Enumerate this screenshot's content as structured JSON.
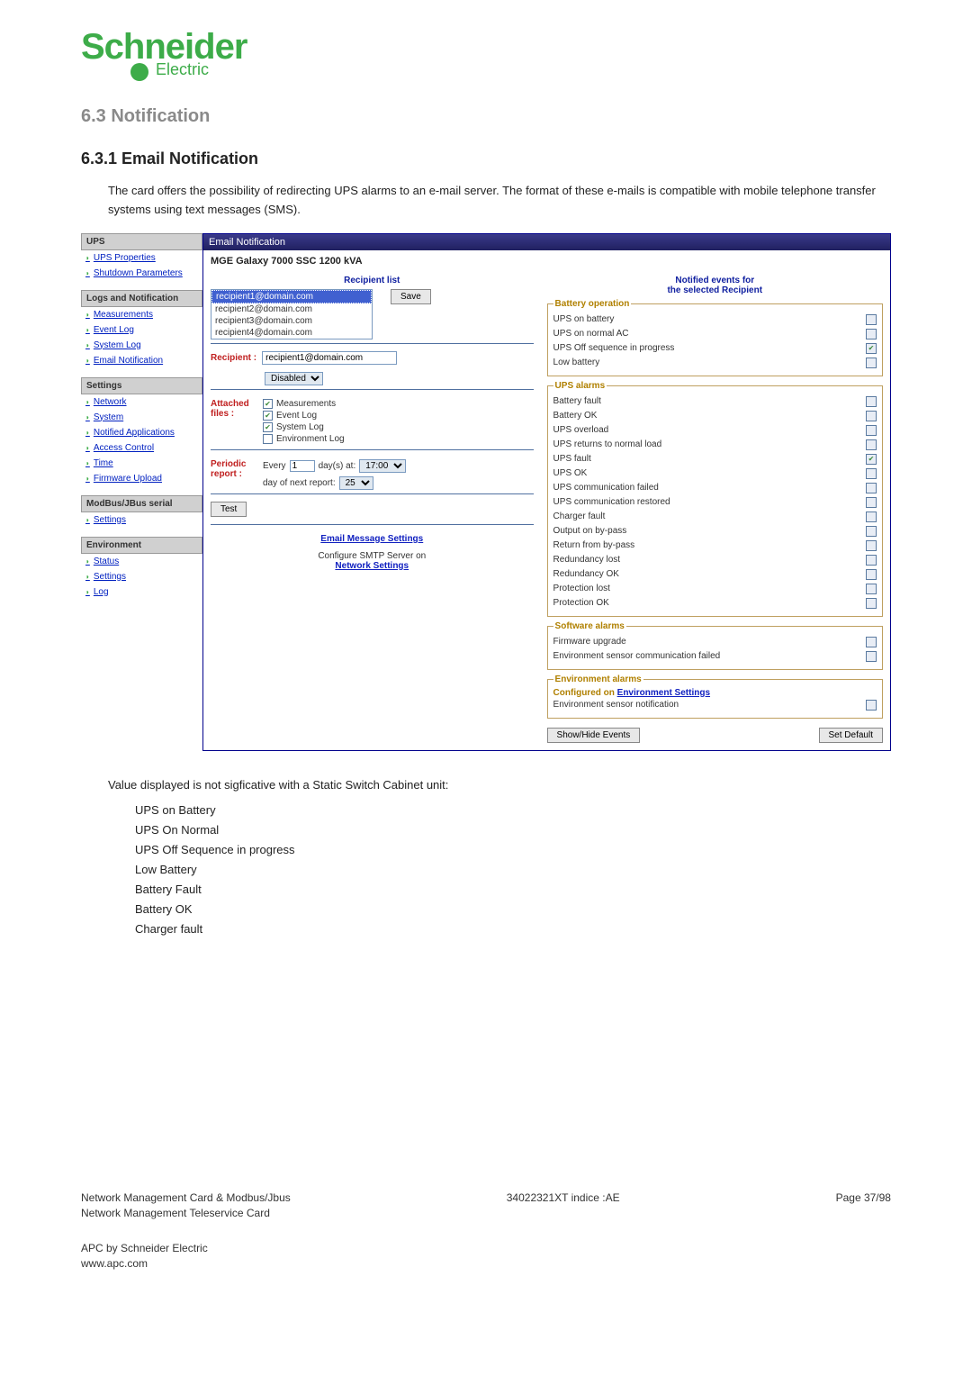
{
  "logo": {
    "main": "Schneider",
    "sub": "Electric"
  },
  "sec63": "6.3   Notification",
  "sec631": "6.3.1   Email Notification",
  "intro": "The card offers the possibility of redirecting UPS alarms to an e-mail server. The format of these e-mails is compatible with mobile telephone transfer systems using text messages (SMS).",
  "sidebar": {
    "cat_ups": "UPS",
    "ups_props": "UPS Properties",
    "shutdown_params": "Shutdown Parameters",
    "cat_logs": "Logs and Notification",
    "measurements": "Measurements",
    "event_log": "Event Log",
    "system_log": "System Log",
    "email_notif": "Email Notification",
    "cat_settings": "Settings",
    "network": "Network",
    "system": "System",
    "notified_apps": "Notified Applications",
    "access_control": "Access Control",
    "time": "Time",
    "fw_upload": "Firmware Upload",
    "cat_modbus": "ModBus/JBus serial",
    "settings": "Settings",
    "cat_env": "Environment",
    "status": "Status",
    "env_settings": "Settings",
    "log": "Log"
  },
  "panel": {
    "header": "Email Notification",
    "device": "MGE Galaxy 7000 SSC 1200 kVA",
    "recipient_list_hdr": "Recipient list",
    "recipients": [
      "recipient1@domain.com",
      "recipient2@domain.com",
      "recipient3@domain.com",
      "recipient4@domain.com"
    ],
    "save": "Save",
    "recipient_label": "Recipient :",
    "recipient_value": "recipient1@domain.com",
    "disabled": "Disabled",
    "attached_label": "Attached files :",
    "attach_meas": "Measurements",
    "attach_event": "Event Log",
    "attach_system": "System Log",
    "attach_envlog": "Environment Log",
    "periodic_label": "Periodic report :",
    "every": "Every",
    "every_val": "1",
    "days_at": "day(s) at:",
    "time_val": "17:00",
    "next_report": "day of next report:",
    "next_val": "25",
    "test": "Test",
    "email_msg_settings": "Email Message Settings",
    "configure_smtp": "Configure SMTP Server on",
    "network_settings": "Network Settings",
    "col_r_hdr1": "Notified events for",
    "col_r_hdr2": "the selected Recipient",
    "grp_battery": "Battery operation",
    "ev_ups_battery": "UPS on battery",
    "ev_ups_normal": "UPS on normal AC",
    "ev_ups_offseq": "UPS Off sequence in progress",
    "ev_low_batt": "Low battery",
    "grp_upsalarms": "UPS alarms",
    "ev_batt_fault": "Battery fault",
    "ev_batt_ok": "Battery OK",
    "ev_ups_overload": "UPS overload",
    "ev_ups_retnorm": "UPS returns to normal load",
    "ev_ups_fault": "UPS fault",
    "ev_ups_ok": "UPS OK",
    "ev_comm_fail": "UPS communication failed",
    "ev_comm_rest": "UPS communication restored",
    "ev_charger_fault": "Charger fault",
    "ev_out_bypass": "Output on by-pass",
    "ev_ret_bypass": "Return from by-pass",
    "ev_red_lost": "Redundancy lost",
    "ev_red_ok": "Redundancy OK",
    "ev_prot_lost": "Protection lost",
    "ev_prot_ok": "Protection OK",
    "grp_sw": "Software alarms",
    "ev_fw_upgrade": "Firmware upgrade",
    "ev_env_comm_fail": "Environment sensor communication failed",
    "grp_env": "Environment alarms",
    "env_cfg_pre": "Configured on ",
    "env_cfg_link": "Environment Settings",
    "ev_env_notif": "Environment sensor notification",
    "btn_showhide": "Show/Hide Events",
    "btn_setdefault": "Set Default"
  },
  "postnote": "Value displayed is not sigficative with a Static Switch Cabinet unit:",
  "bullets": [
    "UPS on Battery",
    "UPS On Normal",
    "UPS Off Sequence in progress",
    "Low Battery",
    "Battery Fault",
    "Battery OK",
    "Charger fault"
  ],
  "footer": {
    "l1a": "Network Management Card & Modbus/Jbus",
    "l1b": "34022321XT indice :AE",
    "l1c": "Page 37/98",
    "l2": "Network Management Teleservice Card",
    "l3": "APC by Schneider Electric",
    "l4": "www.apc.com"
  }
}
